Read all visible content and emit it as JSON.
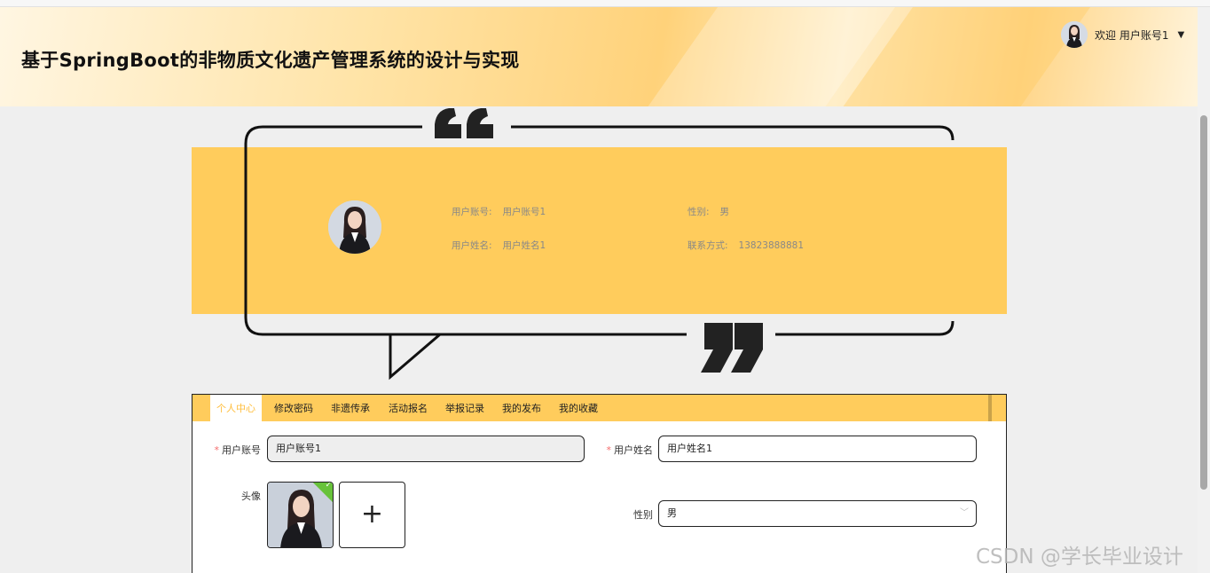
{
  "header": {
    "title": "基于SpringBoot的非物质文化遗产管理系统的设计与实现",
    "welcome": "欢迎 用户账号1"
  },
  "profile": {
    "account_label": "用户账号:",
    "account_value": "用户账号1",
    "name_label": "用户姓名:",
    "name_value": "用户姓名1",
    "gender_label": "性别:",
    "gender_value": "男",
    "contact_label": "联系方式:",
    "contact_value": "13823888881"
  },
  "tabs": [
    {
      "label": "个人中心",
      "active": true
    },
    {
      "label": "修改密码",
      "active": false
    },
    {
      "label": "非遗传承",
      "active": false
    },
    {
      "label": "活动报名",
      "active": false
    },
    {
      "label": "举报记录",
      "active": false
    },
    {
      "label": "我的发布",
      "active": false
    },
    {
      "label": "我的收藏",
      "active": false
    }
  ],
  "form": {
    "account_label": "用户账号",
    "account_value": "用户账号1",
    "name_label": "用户姓名",
    "name_value": "用户姓名1",
    "avatar_label": "头像",
    "add_glyph": "+",
    "gender_label": "性别",
    "gender_value": "男"
  },
  "watermark": "CSDN @学长毕业设计",
  "colors": {
    "accent": "#ffcc5c",
    "active_tab_text": "#ffbe3d",
    "required": "#f56c6c",
    "success": "#67c23a"
  },
  "icons": [
    "open-quote-icon",
    "close-quote-icon",
    "caret-down-icon",
    "plus-icon",
    "check-icon",
    "chevron-down-icon"
  ]
}
